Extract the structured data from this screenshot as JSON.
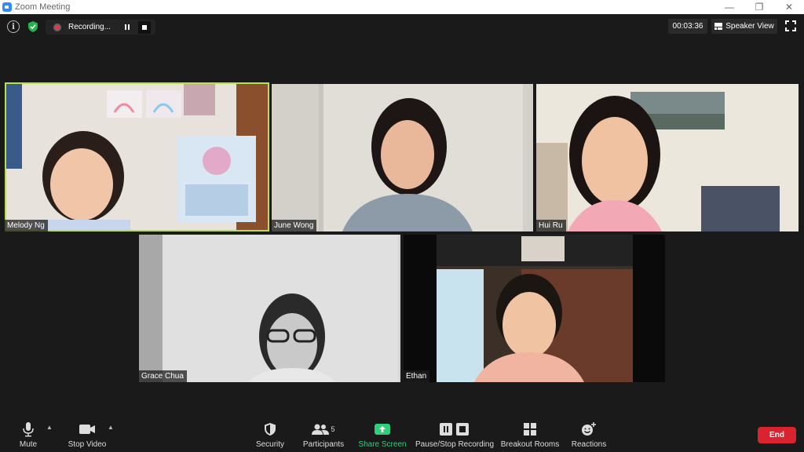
{
  "window": {
    "title": "Zoom Meeting",
    "min": "—",
    "restore": "❐",
    "close": "✕"
  },
  "topbar": {
    "info": "i",
    "recording_label": "Recording...",
    "timer": "00:03:36",
    "view_label": "Speaker View"
  },
  "participants": [
    {
      "name": "Melody Ng",
      "active": true
    },
    {
      "name": "June Wong",
      "active": false
    },
    {
      "name": "Hui Ru",
      "active": false
    },
    {
      "name": "Grace Chua",
      "active": false
    },
    {
      "name": "Ethan",
      "active": false
    }
  ],
  "toolbar": {
    "mute": "Mute",
    "stop_video": "Stop Video",
    "security": "Security",
    "participants": "Participants",
    "participants_count": "5",
    "share_screen": "Share Screen",
    "pause_stop_recording": "Pause/Stop Recording",
    "breakout_rooms": "Breakout Rooms",
    "reactions": "Reactions",
    "end": "End"
  },
  "colors": {
    "accent": "#2d8cff",
    "active_speaker": "#b8e04a",
    "share_green": "#2fd07a",
    "end_red": "#d9232e"
  }
}
